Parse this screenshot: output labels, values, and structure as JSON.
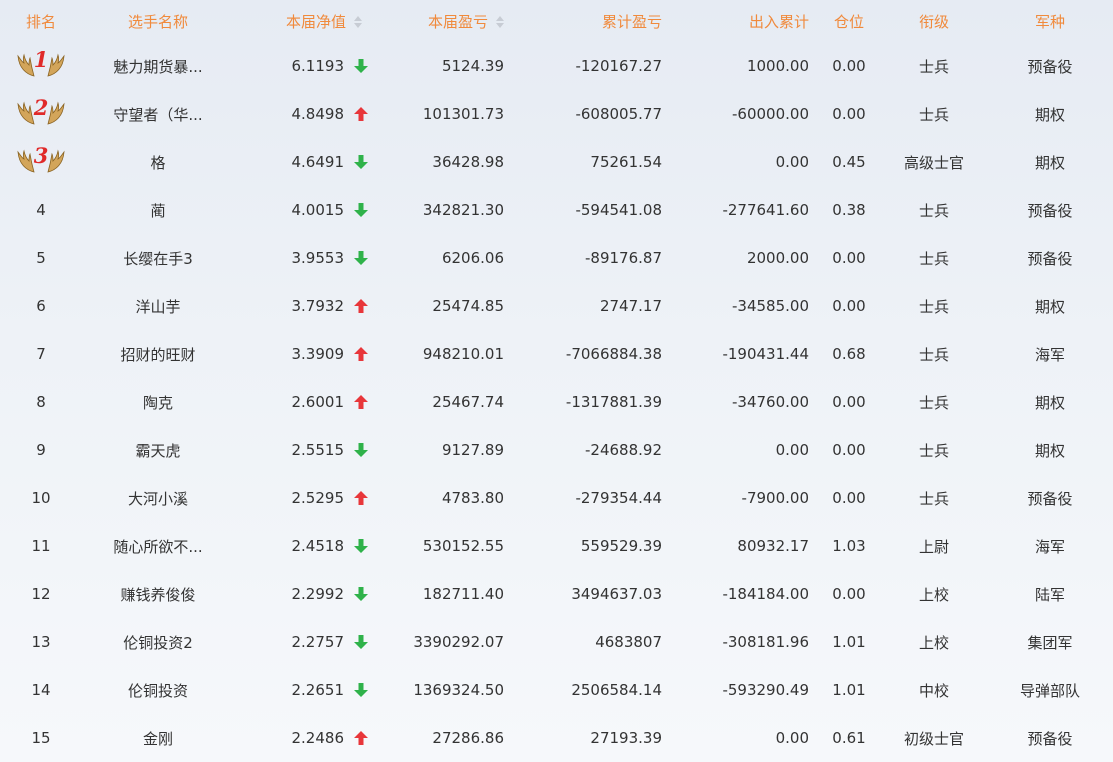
{
  "colors": {
    "header_text": "#f08a3c",
    "up_arrow": "#e8363a",
    "down_arrow": "#2fb24a",
    "rank_number": "#e02a2a"
  },
  "header": {
    "rank": "排名",
    "player_name": "选手名称",
    "net_value": "本届净值",
    "profit": "本届盈亏",
    "cumulative_profit": "累计盈亏",
    "cumulative_flow": "出入累计",
    "position": "仓位",
    "military_rank": "衔级",
    "branch": "军种"
  },
  "rows": [
    {
      "rank": "1",
      "medal": true,
      "name": "魅力期货暴...",
      "net_value": "6.1193",
      "trend": "down",
      "profit": "5124.39",
      "cumulative_profit": "-120167.27",
      "cumulative_flow": "1000.00",
      "position": "0.00",
      "military_rank": "士兵",
      "branch": "预备役"
    },
    {
      "rank": "2",
      "medal": true,
      "name": "守望者（华...",
      "net_value": "4.8498",
      "trend": "up",
      "profit": "101301.73",
      "cumulative_profit": "-608005.77",
      "cumulative_flow": "-60000.00",
      "position": "0.00",
      "military_rank": "士兵",
      "branch": "期权"
    },
    {
      "rank": "3",
      "medal": true,
      "name": "格",
      "net_value": "4.6491",
      "trend": "down",
      "profit": "36428.98",
      "cumulative_profit": "75261.54",
      "cumulative_flow": "0.00",
      "position": "0.45",
      "military_rank": "高级士官",
      "branch": "期权"
    },
    {
      "rank": "4",
      "medal": false,
      "name": "蔺",
      "net_value": "4.0015",
      "trend": "down",
      "profit": "342821.30",
      "cumulative_profit": "-594541.08",
      "cumulative_flow": "-277641.60",
      "position": "0.38",
      "military_rank": "士兵",
      "branch": "预备役"
    },
    {
      "rank": "5",
      "medal": false,
      "name": "长缨在手3",
      "net_value": "3.9553",
      "trend": "down",
      "profit": "6206.06",
      "cumulative_profit": "-89176.87",
      "cumulative_flow": "2000.00",
      "position": "0.00",
      "military_rank": "士兵",
      "branch": "预备役"
    },
    {
      "rank": "6",
      "medal": false,
      "name": "洋山芋",
      "net_value": "3.7932",
      "trend": "up",
      "profit": "25474.85",
      "cumulative_profit": "2747.17",
      "cumulative_flow": "-34585.00",
      "position": "0.00",
      "military_rank": "士兵",
      "branch": "期权"
    },
    {
      "rank": "7",
      "medal": false,
      "name": "招财的旺财",
      "net_value": "3.3909",
      "trend": "up",
      "profit": "948210.01",
      "cumulative_profit": "-7066884.38",
      "cumulative_flow": "-190431.44",
      "position": "0.68",
      "military_rank": "士兵",
      "branch": "海军"
    },
    {
      "rank": "8",
      "medal": false,
      "name": "陶克",
      "net_value": "2.6001",
      "trend": "up",
      "profit": "25467.74",
      "cumulative_profit": "-1317881.39",
      "cumulative_flow": "-34760.00",
      "position": "0.00",
      "military_rank": "士兵",
      "branch": "期权"
    },
    {
      "rank": "9",
      "medal": false,
      "name": "霸天虎",
      "net_value": "2.5515",
      "trend": "down",
      "profit": "9127.89",
      "cumulative_profit": "-24688.92",
      "cumulative_flow": "0.00",
      "position": "0.00",
      "military_rank": "士兵",
      "branch": "期权"
    },
    {
      "rank": "10",
      "medal": false,
      "name": "大河小溪",
      "net_value": "2.5295",
      "trend": "up",
      "profit": "4783.80",
      "cumulative_profit": "-279354.44",
      "cumulative_flow": "-7900.00",
      "position": "0.00",
      "military_rank": "士兵",
      "branch": "预备役"
    },
    {
      "rank": "11",
      "medal": false,
      "name": "随心所欲不...",
      "net_value": "2.4518",
      "trend": "down",
      "profit": "530152.55",
      "cumulative_profit": "559529.39",
      "cumulative_flow": "80932.17",
      "position": "1.03",
      "military_rank": "上尉",
      "branch": "海军"
    },
    {
      "rank": "12",
      "medal": false,
      "name": "赚钱养俊俊",
      "net_value": "2.2992",
      "trend": "down",
      "profit": "182711.40",
      "cumulative_profit": "3494637.03",
      "cumulative_flow": "-184184.00",
      "position": "0.00",
      "military_rank": "上校",
      "branch": "陆军"
    },
    {
      "rank": "13",
      "medal": false,
      "name": "伦铜投资2",
      "net_value": "2.2757",
      "trend": "down",
      "profit": "3390292.07",
      "cumulative_profit": "4683807",
      "cumulative_flow": "-308181.96",
      "position": "1.01",
      "military_rank": "上校",
      "branch": "集团军"
    },
    {
      "rank": "14",
      "medal": false,
      "name": "伦铜投资",
      "net_value": "2.2651",
      "trend": "down",
      "profit": "1369324.50",
      "cumulative_profit": "2506584.14",
      "cumulative_flow": "-593290.49",
      "position": "1.01",
      "military_rank": "中校",
      "branch": "导弹部队"
    },
    {
      "rank": "15",
      "medal": false,
      "name": "金刚",
      "net_value": "2.2486",
      "trend": "up",
      "profit": "27286.86",
      "cumulative_profit": "27193.39",
      "cumulative_flow": "0.00",
      "position": "0.61",
      "military_rank": "初级士官",
      "branch": "预备役"
    }
  ]
}
